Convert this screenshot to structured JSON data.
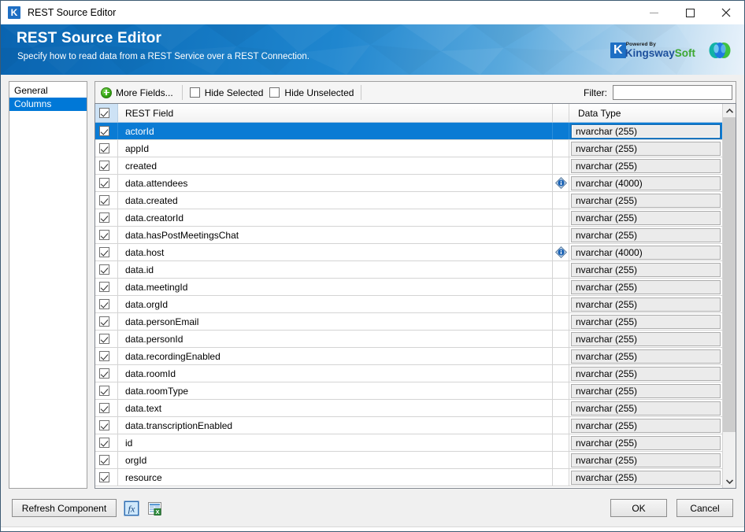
{
  "window": {
    "title": "REST Source Editor",
    "app_icon": "K",
    "controls": {
      "minimize": "minimize-icon",
      "maximize": "maximize-icon",
      "close": "close-icon"
    }
  },
  "banner": {
    "title": "REST Source Editor",
    "subtitle": "Specify how to read data from a REST Service over a REST Connection.",
    "brand": {
      "mark": "K",
      "powered_by": "Powered By",
      "name_primary": "Kingsway",
      "name_secondary": "Soft",
      "primary_color": "#1c4f9c",
      "secondary_color": "#3ea832"
    },
    "product_icon": "webex-icon",
    "background_color": "#1174bf"
  },
  "sidebar": {
    "items": [
      {
        "label": "General",
        "selected": false
      },
      {
        "label": "Columns",
        "selected": true
      }
    ],
    "selected_color": "#0078d7"
  },
  "toolbar": {
    "more_fields_label": "More Fields...",
    "hide_selected_label": "Hide Selected",
    "hide_selected_checked": false,
    "hide_unselected_label": "Hide Unselected",
    "hide_unselected_checked": false,
    "filter_label": "Filter:",
    "filter_value": "",
    "filter_placeholder": ""
  },
  "grid": {
    "header": {
      "select_all_checked": true,
      "field_column": "REST Field",
      "type_column": "Data Type"
    },
    "rows": [
      {
        "checked": true,
        "field": "actorId",
        "info": false,
        "type": "nvarchar (255)",
        "selected": true
      },
      {
        "checked": true,
        "field": "appId",
        "info": false,
        "type": "nvarchar (255)",
        "selected": false
      },
      {
        "checked": true,
        "field": "created",
        "info": false,
        "type": "nvarchar (255)",
        "selected": false
      },
      {
        "checked": true,
        "field": "data.attendees",
        "info": true,
        "type": "nvarchar (4000)",
        "selected": false
      },
      {
        "checked": true,
        "field": "data.created",
        "info": false,
        "type": "nvarchar (255)",
        "selected": false
      },
      {
        "checked": true,
        "field": "data.creatorId",
        "info": false,
        "type": "nvarchar (255)",
        "selected": false
      },
      {
        "checked": true,
        "field": "data.hasPostMeetingsChat",
        "info": false,
        "type": "nvarchar (255)",
        "selected": false
      },
      {
        "checked": true,
        "field": "data.host",
        "info": true,
        "type": "nvarchar (4000)",
        "selected": false
      },
      {
        "checked": true,
        "field": "data.id",
        "info": false,
        "type": "nvarchar (255)",
        "selected": false
      },
      {
        "checked": true,
        "field": "data.meetingId",
        "info": false,
        "type": "nvarchar (255)",
        "selected": false
      },
      {
        "checked": true,
        "field": "data.orgId",
        "info": false,
        "type": "nvarchar (255)",
        "selected": false
      },
      {
        "checked": true,
        "field": "data.personEmail",
        "info": false,
        "type": "nvarchar (255)",
        "selected": false
      },
      {
        "checked": true,
        "field": "data.personId",
        "info": false,
        "type": "nvarchar (255)",
        "selected": false
      },
      {
        "checked": true,
        "field": "data.recordingEnabled",
        "info": false,
        "type": "nvarchar (255)",
        "selected": false
      },
      {
        "checked": true,
        "field": "data.roomId",
        "info": false,
        "type": "nvarchar (255)",
        "selected": false
      },
      {
        "checked": true,
        "field": "data.roomType",
        "info": false,
        "type": "nvarchar (255)",
        "selected": false
      },
      {
        "checked": true,
        "field": "data.text",
        "info": false,
        "type": "nvarchar (255)",
        "selected": false
      },
      {
        "checked": true,
        "field": "data.transcriptionEnabled",
        "info": false,
        "type": "nvarchar (255)",
        "selected": false
      },
      {
        "checked": true,
        "field": "id",
        "info": false,
        "type": "nvarchar (255)",
        "selected": false
      },
      {
        "checked": true,
        "field": "orgId",
        "info": false,
        "type": "nvarchar (255)",
        "selected": false
      },
      {
        "checked": true,
        "field": "resource",
        "info": false,
        "type": "nvarchar (255)",
        "selected": false
      }
    ],
    "selected_row_color": "#0a7bd4"
  },
  "footer": {
    "refresh_label": "Refresh Component",
    "expression_icon": "fx-icon",
    "export_icon": "export-excel-icon",
    "ok_label": "OK",
    "cancel_label": "Cancel"
  }
}
